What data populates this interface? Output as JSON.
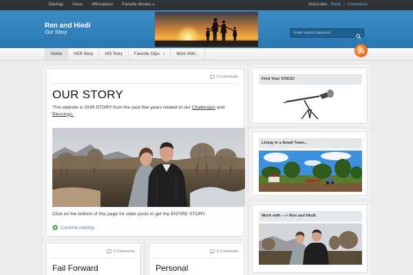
{
  "topbar": {
    "nav": [
      {
        "label": "Sitemap"
      },
      {
        "label": "Voice"
      },
      {
        "label": "Affirmations"
      },
      {
        "label": "Favorite Movies"
      }
    ],
    "subscribe_label": "Subscribe:",
    "posts_link": "Posts",
    "separator": "|",
    "comments_link": "Comments"
  },
  "header": {
    "site_title": "Ren and Hiedi",
    "tagline": "Our Story",
    "search_placeholder": "Enter search keyword"
  },
  "nav": {
    "items": [
      {
        "label": "Home"
      },
      {
        "label": "HER Story"
      },
      {
        "label": "HIS Story"
      },
      {
        "label": "Favorite Clips"
      },
      {
        "label": "Work With..."
      }
    ]
  },
  "featured_post": {
    "comments": "0 Comments",
    "title": "OUR STORY",
    "intro_before": "This website is OUR STORY from the past few years related to our ",
    "link_challenges": "Challenges",
    "intro_and": " and ",
    "link_blessings": "Blessings.",
    "bottom_text": "Click on the bottom of this page for older posts to get the ENTIRE STORY.",
    "continue_label": "Continue reading..."
  },
  "posts": [
    {
      "comments": "0 Comments",
      "title": "Fail Forward"
    },
    {
      "comments": "0 Comments",
      "title": "Personal"
    }
  ],
  "sidebar": {
    "widgets": [
      {
        "title": "Find Your VOICE!"
      },
      {
        "title": "Living in a Small Town..."
      },
      {
        "title": "Work with ---> Ren and Hiedi"
      }
    ]
  },
  "colors": {
    "header_blue": "#2f82bf",
    "link_blue": "#3585bd",
    "topbar_dark": "#2f3336",
    "rss_orange": "#ef6a12"
  },
  "icons": {
    "search": "magnifier-icon",
    "comments": "speech-bubble-icon",
    "continue": "green-arrow-circle-icon",
    "rss": "rss-feed-icon"
  }
}
